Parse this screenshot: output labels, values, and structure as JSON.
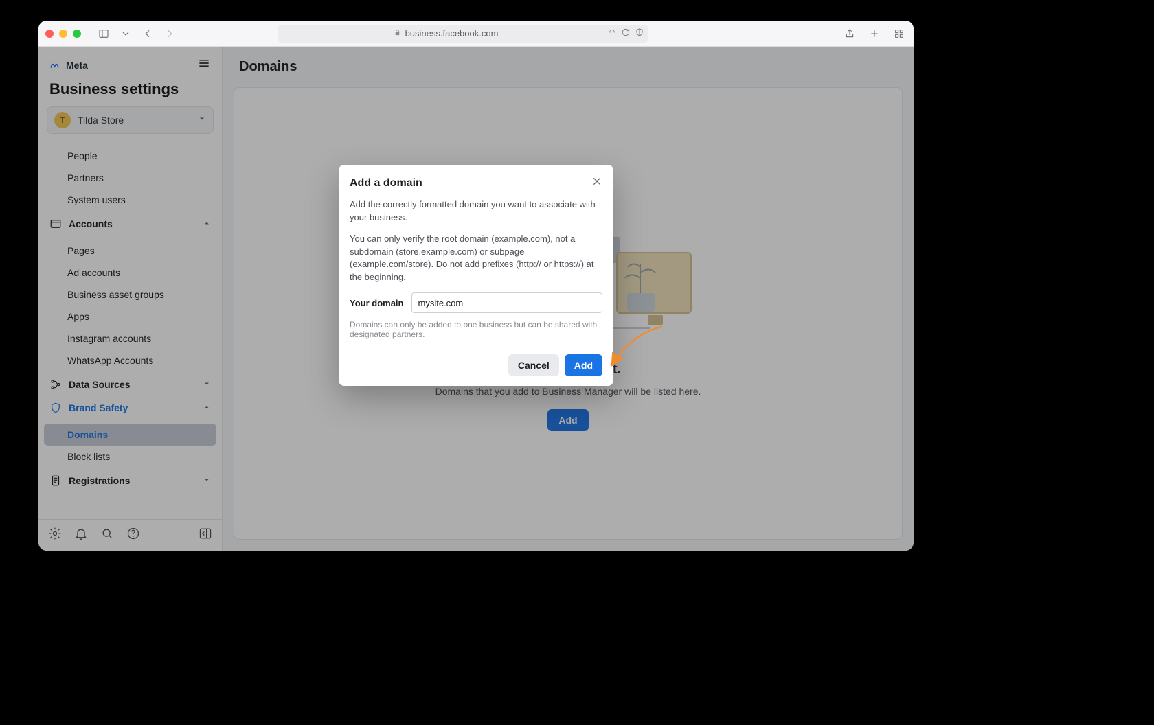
{
  "browser": {
    "url_host": "business.facebook.com"
  },
  "sidebar": {
    "brand": "Meta",
    "title": "Business settings",
    "account": {
      "initial": "T",
      "name": "Tilda Store"
    },
    "users": {
      "items": [
        "People",
        "Partners",
        "System users"
      ]
    },
    "accounts": {
      "label": "Accounts",
      "items": [
        "Pages",
        "Ad accounts",
        "Business asset groups",
        "Apps",
        "Instagram accounts",
        "WhatsApp Accounts"
      ]
    },
    "data_sources": {
      "label": "Data Sources"
    },
    "brand_safety": {
      "label": "Brand Safety",
      "items": [
        "Domains",
        "Block lists"
      ],
      "active_index": 0
    },
    "registrations": {
      "label": "Registrations"
    }
  },
  "main": {
    "title": "Domains",
    "empty_heading": "No domains yet.",
    "empty_text": "Domains that you add to Business Manager will be listed here.",
    "empty_cta": "Add"
  },
  "modal": {
    "title": "Add a domain",
    "p1": "Add the correctly formatted domain you want to associate with your business.",
    "p2": "You can only verify the root domain (example.com), not a subdomain (store.example.com) or subpage (example.com/store). Do not add prefixes (http:// or https://) at the beginning.",
    "field_label": "Your domain",
    "field_value": "mysite.com",
    "hint": "Domains can only be added to one business but can be shared with designated partners.",
    "cancel": "Cancel",
    "submit": "Add"
  }
}
